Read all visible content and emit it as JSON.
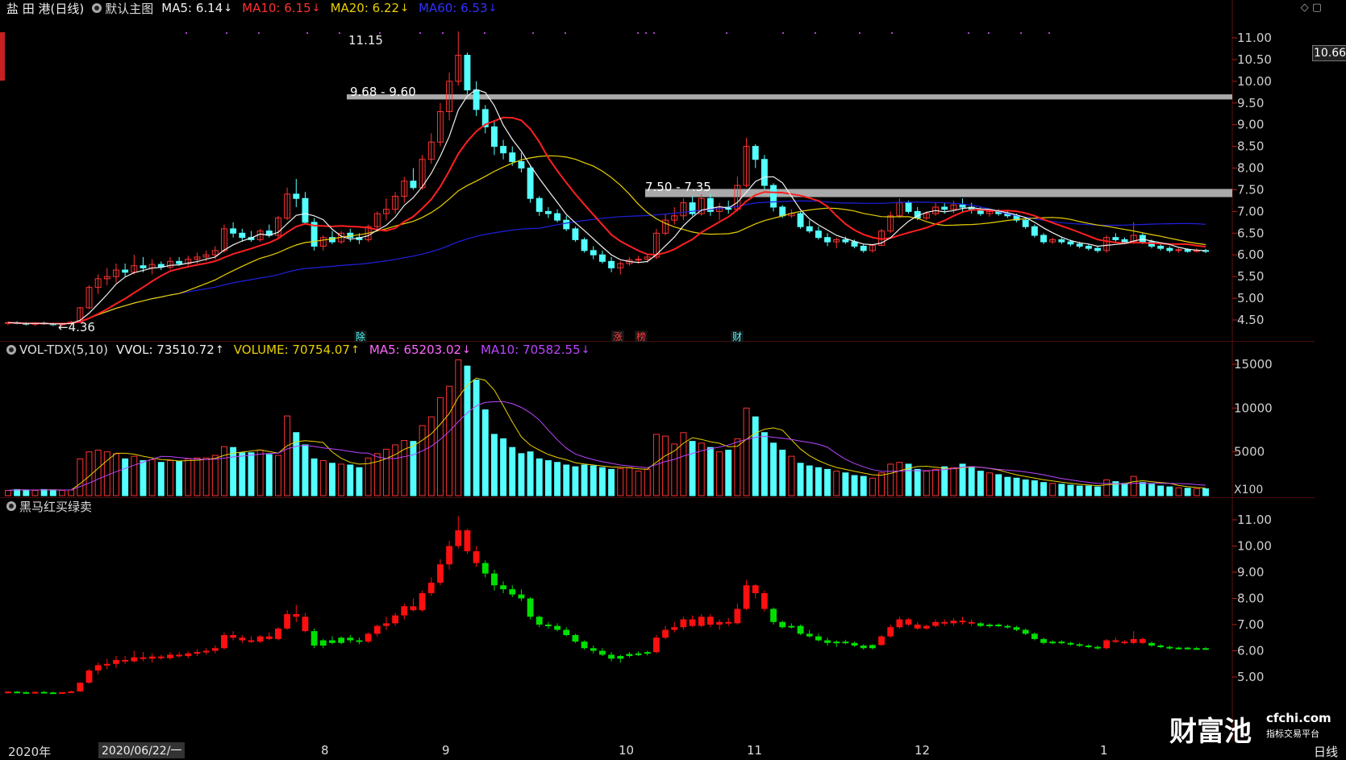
{
  "header_main": {
    "title": "盐 田 港(日线)",
    "template": "默认主图",
    "indicators": [
      {
        "label": "MA5: 6.14",
        "color": "#f0f0f0",
        "arrow": "↓"
      },
      {
        "label": "MA10: 6.15",
        "color": "#ff3030",
        "arrow": "↓"
      },
      {
        "label": "MA20: 6.22",
        "color": "#e8d000",
        "arrow": "↓"
      },
      {
        "label": "MA60: 6.53",
        "color": "#3030ff",
        "arrow": "↓"
      }
    ]
  },
  "header_volume": {
    "title": "VOL-TDX(5,10)",
    "indicators": [
      {
        "label": "VVOL: 73510.72",
        "color": "#f0f0f0",
        "arrow": "↑"
      },
      {
        "label": "VOLUME: 70754.07",
        "color": "#e8d000",
        "arrow": "↑"
      },
      {
        "label": "MA5: 65203.02",
        "color": "#ff66ff",
        "arrow": "↓"
      },
      {
        "label": "MA10: 70582.55",
        "color": "#bb44ff",
        "arrow": "↓"
      }
    ]
  },
  "header_third": {
    "title": "黑马红买绿卖"
  },
  "price_axis": [
    "11.00",
    "10.50",
    "10.00",
    "9.50",
    "9.00",
    "8.50",
    "8.00",
    "7.50",
    "7.00",
    "6.50",
    "6.00",
    "5.50",
    "5.00",
    "4.50"
  ],
  "current_price": "10.66",
  "volume_axis": [
    "15000",
    "10000",
    "5000"
  ],
  "volume_unit": "X100",
  "third_axis": [
    "11.00",
    "10.00",
    "9.00",
    "8.00",
    "7.00",
    "6.00",
    "5.00"
  ],
  "annotations": {
    "high": "11.15",
    "low": "4.36",
    "zone1": "9.68 - 9.60",
    "zone2": "7.50 - 7.35"
  },
  "event_markers": [
    "除",
    "涨",
    "榜",
    "财"
  ],
  "x_axis": [
    "2020年",
    "8",
    "9",
    "10",
    "11",
    "12",
    "1"
  ],
  "cursor_date": "2020/06/22/一",
  "period": "日线",
  "logo": {
    "main": "财富池",
    "domain": "cfchi.com",
    "sub": "指标交易平台"
  },
  "colors": {
    "up": "#ff3232",
    "down": "#54ffff",
    "ma5": "#f0f0f0",
    "ma10": "#ff2020",
    "ma20": "#e8d000",
    "ma60": "#2020e0",
    "green": "#00e000",
    "red": "#ff1010",
    "zone": "#aaaaaa"
  },
  "chart_data": [
    {
      "type": "candlestick",
      "title": "盐 田 港(日线)",
      "x": [
        "2020年",
        "8",
        "9",
        "10",
        "11",
        "12",
        "1"
      ],
      "ylim": [
        4.3,
        11.2
      ],
      "ohlc": [
        [
          4.42,
          4.46,
          4.38,
          4.44
        ],
        [
          4.44,
          4.47,
          4.4,
          4.42
        ],
        [
          4.42,
          4.45,
          4.37,
          4.4
        ],
        [
          4.4,
          4.44,
          4.36,
          4.43
        ],
        [
          4.43,
          4.46,
          4.39,
          4.41
        ],
        [
          4.41,
          4.44,
          4.36,
          4.39
        ],
        [
          4.39,
          4.43,
          4.36,
          4.42
        ],
        [
          4.42,
          4.48,
          4.4,
          4.45
        ],
        [
          4.45,
          4.8,
          4.43,
          4.78
        ],
        [
          4.78,
          5.3,
          4.75,
          5.25
        ],
        [
          5.25,
          5.55,
          5.1,
          5.45
        ],
        [
          5.45,
          5.7,
          5.3,
          5.5
        ],
        [
          5.5,
          5.8,
          5.35,
          5.65
        ],
        [
          5.65,
          5.8,
          5.5,
          5.6
        ],
        [
          5.6,
          6.0,
          5.55,
          5.75
        ],
        [
          5.75,
          5.95,
          5.6,
          5.7
        ],
        [
          5.7,
          5.9,
          5.55,
          5.78
        ],
        [
          5.78,
          5.85,
          5.65,
          5.72
        ],
        [
          5.72,
          5.95,
          5.66,
          5.85
        ],
        [
          5.85,
          5.95,
          5.75,
          5.8
        ],
        [
          5.8,
          5.98,
          5.72,
          5.9
        ],
        [
          5.9,
          6.05,
          5.8,
          5.95
        ],
        [
          5.95,
          6.1,
          5.85,
          6.0
        ],
        [
          6.0,
          6.2,
          5.9,
          6.1
        ],
        [
          6.1,
          6.7,
          6.05,
          6.6
        ],
        [
          6.6,
          6.75,
          6.4,
          6.5
        ],
        [
          6.5,
          6.6,
          6.3,
          6.4
        ],
        [
          6.4,
          6.55,
          6.3,
          6.35
        ],
        [
          6.35,
          6.6,
          6.3,
          6.55
        ],
        [
          6.55,
          6.7,
          6.4,
          6.45
        ],
        [
          6.45,
          6.9,
          6.4,
          6.85
        ],
        [
          6.85,
          7.55,
          6.8,
          7.4
        ],
        [
          7.4,
          7.75,
          7.1,
          7.3
        ],
        [
          7.3,
          7.45,
          6.7,
          6.75
        ],
        [
          6.75,
          6.85,
          6.1,
          6.2
        ],
        [
          6.2,
          6.45,
          6.1,
          6.4
        ],
        [
          6.4,
          6.55,
          6.25,
          6.3
        ],
        [
          6.3,
          6.55,
          6.25,
          6.5
        ],
        [
          6.5,
          6.6,
          6.3,
          6.4
        ],
        [
          6.4,
          6.5,
          6.25,
          6.35
        ],
        [
          6.35,
          6.7,
          6.3,
          6.65
        ],
        [
          6.65,
          7.0,
          6.55,
          6.95
        ],
        [
          6.95,
          7.3,
          6.8,
          7.05
        ],
        [
          7.05,
          7.45,
          6.95,
          7.35
        ],
        [
          7.35,
          7.8,
          7.2,
          7.7
        ],
        [
          7.7,
          8.0,
          7.5,
          7.55
        ],
        [
          7.55,
          8.3,
          7.5,
          8.2
        ],
        [
          8.2,
          8.8,
          8.1,
          8.6
        ],
        [
          8.6,
          9.5,
          8.5,
          9.3
        ],
        [
          9.3,
          10.2,
          9.1,
          10.0
        ],
        [
          10.0,
          11.15,
          9.9,
          10.6
        ],
        [
          10.6,
          10.66,
          9.7,
          9.8
        ],
        [
          9.8,
          10.0,
          9.2,
          9.35
        ],
        [
          9.35,
          9.45,
          8.8,
          8.95
        ],
        [
          8.95,
          9.1,
          8.3,
          8.5
        ],
        [
          8.5,
          8.65,
          8.2,
          8.35
        ],
        [
          8.35,
          8.5,
          8.05,
          8.15
        ],
        [
          8.15,
          8.35,
          7.9,
          8.0
        ],
        [
          8.0,
          8.05,
          7.2,
          7.3
        ],
        [
          7.3,
          7.35,
          6.9,
          7.0
        ],
        [
          7.0,
          7.1,
          6.85,
          6.95
        ],
        [
          6.95,
          7.05,
          6.75,
          6.8
        ],
        [
          6.8,
          6.9,
          6.55,
          6.6
        ],
        [
          6.6,
          6.65,
          6.3,
          6.35
        ],
        [
          6.35,
          6.4,
          6.05,
          6.1
        ],
        [
          6.1,
          6.2,
          5.9,
          6.0
        ],
        [
          6.0,
          6.1,
          5.8,
          5.85
        ],
        [
          5.85,
          5.95,
          5.6,
          5.7
        ],
        [
          5.7,
          5.85,
          5.55,
          5.8
        ],
        [
          5.8,
          5.95,
          5.75,
          5.88
        ],
        [
          5.88,
          5.98,
          5.8,
          5.9
        ],
        [
          5.9,
          6.0,
          5.82,
          5.95
        ],
        [
          5.95,
          6.6,
          5.9,
          6.5
        ],
        [
          6.5,
          6.95,
          6.45,
          6.8
        ],
        [
          6.8,
          7.1,
          6.7,
          6.9
        ],
        [
          6.9,
          7.3,
          6.8,
          7.2
        ],
        [
          7.2,
          7.35,
          6.9,
          6.95
        ],
        [
          6.95,
          7.4,
          6.9,
          7.3
        ],
        [
          7.3,
          7.4,
          6.9,
          7.0
        ],
        [
          7.0,
          7.2,
          6.8,
          7.1
        ],
        [
          7.1,
          7.25,
          6.95,
          7.05
        ],
        [
          7.05,
          7.8,
          7.0,
          7.6
        ],
        [
          7.6,
          8.7,
          7.55,
          8.5
        ],
        [
          8.5,
          8.55,
          8.0,
          8.2
        ],
        [
          8.2,
          8.3,
          7.5,
          7.6
        ],
        [
          7.6,
          7.65,
          7.0,
          7.1
        ],
        [
          7.1,
          7.15,
          6.85,
          6.9
        ],
        [
          6.9,
          7.05,
          6.85,
          6.95
        ],
        [
          6.95,
          7.0,
          6.6,
          6.65
        ],
        [
          6.65,
          6.8,
          6.5,
          6.55
        ],
        [
          6.55,
          6.65,
          6.35,
          6.4
        ],
        [
          6.4,
          6.5,
          6.2,
          6.3
        ],
        [
          6.3,
          6.4,
          6.15,
          6.35
        ],
        [
          6.35,
          6.42,
          6.25,
          6.3
        ],
        [
          6.3,
          6.35,
          6.15,
          6.2
        ],
        [
          6.2,
          6.25,
          6.05,
          6.1
        ],
        [
          6.1,
          6.25,
          6.05,
          6.22
        ],
        [
          6.22,
          6.6,
          6.2,
          6.55
        ],
        [
          6.55,
          7.0,
          6.5,
          6.9
        ],
        [
          6.9,
          7.3,
          6.85,
          7.2
        ],
        [
          7.2,
          7.25,
          6.95,
          7.0
        ],
        [
          7.0,
          7.1,
          6.8,
          6.85
        ],
        [
          6.85,
          7.0,
          6.8,
          6.95
        ],
        [
          6.95,
          7.2,
          6.9,
          7.1
        ],
        [
          7.1,
          7.2,
          6.95,
          7.05
        ],
        [
          7.05,
          7.25,
          6.95,
          7.15
        ],
        [
          7.15,
          7.3,
          7.0,
          7.1
        ],
        [
          7.1,
          7.2,
          6.95,
          7.05
        ],
        [
          7.05,
          7.1,
          6.9,
          6.95
        ],
        [
          6.95,
          7.05,
          6.88,
          7.0
        ],
        [
          7.0,
          7.05,
          6.9,
          6.95
        ],
        [
          6.95,
          7.0,
          6.85,
          6.9
        ],
        [
          6.9,
          6.95,
          6.75,
          6.8
        ],
        [
          6.8,
          6.85,
          6.6,
          6.65
        ],
        [
          6.65,
          6.7,
          6.4,
          6.45
        ],
        [
          6.45,
          6.5,
          6.25,
          6.3
        ],
        [
          6.3,
          6.4,
          6.25,
          6.35
        ],
        [
          6.35,
          6.4,
          6.25,
          6.3
        ],
        [
          6.3,
          6.35,
          6.2,
          6.25
        ],
        [
          6.25,
          6.3,
          6.15,
          6.2
        ],
        [
          6.2,
          6.25,
          6.1,
          6.15
        ],
        [
          6.15,
          6.2,
          6.05,
          6.1
        ],
        [
          6.1,
          6.45,
          6.05,
          6.4
        ],
        [
          6.4,
          6.5,
          6.3,
          6.35
        ],
        [
          6.35,
          6.4,
          6.25,
          6.3
        ],
        [
          6.3,
          6.75,
          6.25,
          6.45
        ],
        [
          6.45,
          6.5,
          6.25,
          6.3
        ],
        [
          6.3,
          6.35,
          6.15,
          6.2
        ],
        [
          6.2,
          6.25,
          6.1,
          6.15
        ],
        [
          6.15,
          6.2,
          6.05,
          6.1
        ],
        [
          6.1,
          6.15,
          6.05,
          6.12
        ],
        [
          6.12,
          6.15,
          6.05,
          6.08
        ],
        [
          6.08,
          6.15,
          6.05,
          6.1
        ],
        [
          6.1,
          6.14,
          6.04,
          6.08
        ]
      ]
    },
    {
      "type": "bar",
      "title": "VOL-TDX(5,10)",
      "ylim": [
        0,
        16000
      ],
      "series": [
        {
          "name": "VOLUME",
          "values": [
            600,
            700,
            650,
            600,
            700,
            650,
            600,
            650,
            4200,
            5000,
            5200,
            5000,
            4800,
            4200,
            4500,
            4000,
            4100,
            3800,
            4000,
            3900,
            4200,
            4300,
            4300,
            4600,
            5600,
            5500,
            4900,
            4900,
            5200,
            4700,
            4600,
            9100,
            7200,
            5800,
            4200,
            4000,
            3700,
            3600,
            3500,
            3200,
            4300,
            4800,
            5300,
            5800,
            6300,
            6200,
            8000,
            9000,
            11200,
            12500,
            15500,
            14800,
            13200,
            9800,
            7000,
            6500,
            5500,
            4800,
            5000,
            4200,
            4000,
            3800,
            3500,
            3300,
            3500,
            3400,
            3200,
            3000,
            3100,
            3200,
            2800,
            3000,
            7000,
            6800,
            5900,
            7200,
            6200,
            6000,
            5500,
            5000,
            5200,
            6500,
            10000,
            9000,
            7200,
            6000,
            5200,
            4500,
            3700,
            3400,
            3200,
            3000,
            2800,
            2600,
            2300,
            2200,
            2000,
            2600,
            3600,
            3800,
            3600,
            3000,
            2800,
            3000,
            3300,
            3200,
            3600,
            3300,
            2800,
            2600,
            2400,
            2100,
            2000,
            1800,
            1700,
            1500,
            1400,
            1300,
            1200,
            1100,
            1100,
            1000,
            1800,
            1600,
            1400,
            2200,
            1500,
            1300,
            1100,
            1000,
            900,
            850,
            800,
            780
          ]
        }
      ]
    }
  ]
}
